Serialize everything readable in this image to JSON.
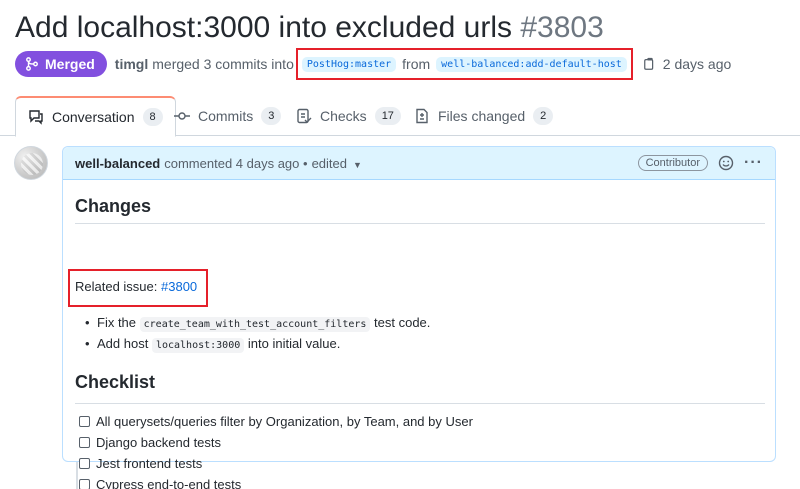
{
  "pr": {
    "title": "Add localhost:3000 into excluded urls",
    "number": "#3803",
    "status": "Merged",
    "author": "timgl",
    "merge_text": "merged 3 commits into",
    "base_branch": "PostHog:master",
    "from_text": "from",
    "head_branch": "well-balanced:add-default-host",
    "time": "2 days ago"
  },
  "tabs": [
    {
      "label": "Conversation",
      "count": "8",
      "icon": "conversation-icon"
    },
    {
      "label": "Commits",
      "count": "3",
      "icon": "commit-icon"
    },
    {
      "label": "Checks",
      "count": "17",
      "icon": "checklist-icon"
    },
    {
      "label": "Files changed",
      "count": "2",
      "icon": "file-diff-icon"
    }
  ],
  "comment": {
    "author": "well-balanced",
    "meta": "commented 4 days ago •",
    "edited": "edited",
    "role": "Contributor",
    "changes_heading": "Changes",
    "related_label": "Related issue:",
    "related_link": "#3800",
    "bullets": [
      {
        "pre": "Fix the",
        "code": "create_team_with_test_account_filters",
        "post": "test code."
      },
      {
        "pre": "Add host",
        "code": "localhost:3000",
        "post": "into initial value."
      }
    ],
    "checklist_heading": "Checklist",
    "checklist": [
      "All querysets/queries filter by Organization, by Team, and by User",
      "Django backend tests",
      "Jest frontend tests",
      "Cypress end-to-end tests"
    ]
  },
  "colors": {
    "merged": "#8250df",
    "link": "#0969da",
    "highlight_box": "#e5202a"
  }
}
